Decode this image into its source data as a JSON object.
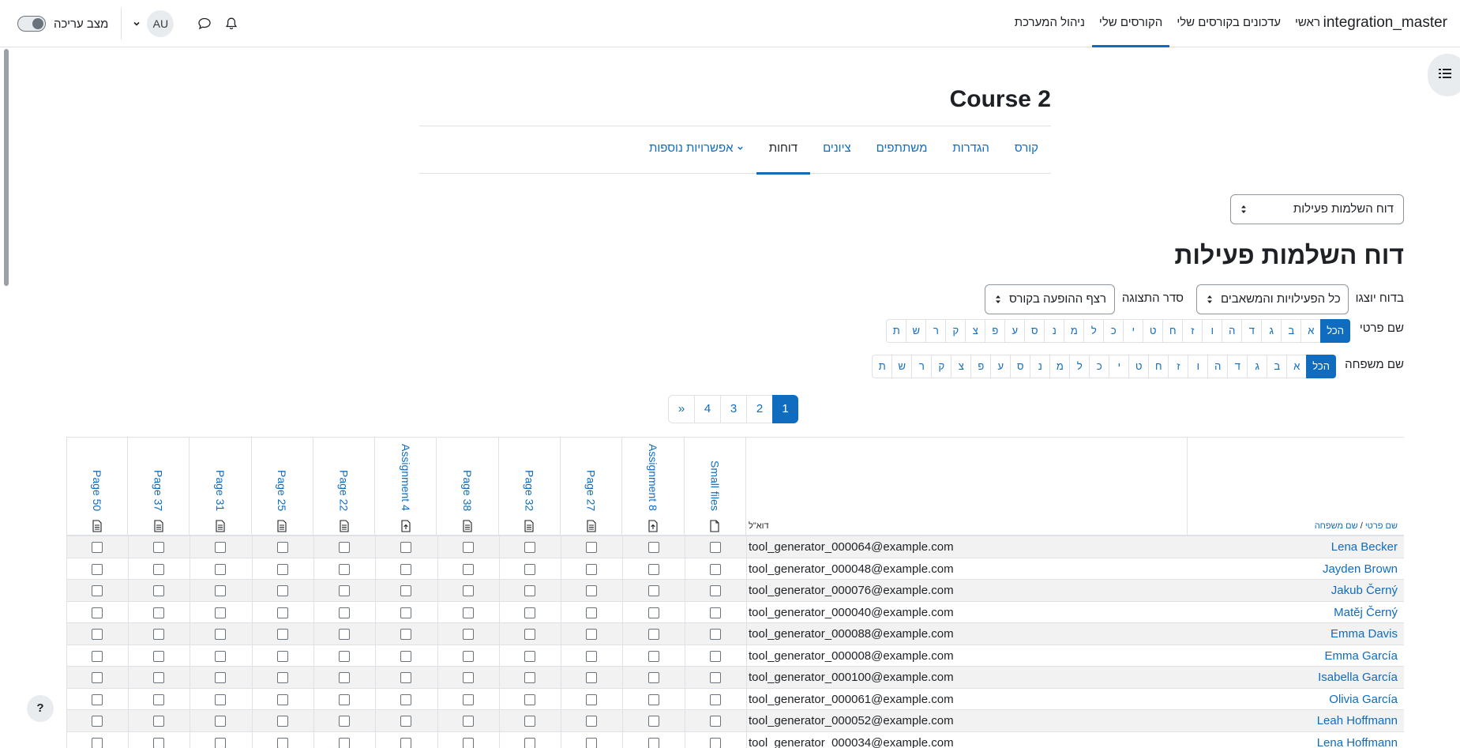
{
  "navbar": {
    "site_name": "integration_master",
    "items": [
      {
        "label": "ראשי",
        "active": false
      },
      {
        "label": "עדכונים בקורסים שלי",
        "active": false
      },
      {
        "label": "הקורסים שלי",
        "active": true
      },
      {
        "label": "ניהול המערכת",
        "active": false
      }
    ],
    "user_initials": "AU",
    "edit_mode_label": "מצב עריכה"
  },
  "course": {
    "title": "Course 2",
    "tabs": [
      "קורס",
      "הגדרות",
      "משתתפים",
      "ציונים",
      "דוחות",
      "אפשרויות נוספות"
    ],
    "active_tab": "דוחות"
  },
  "report": {
    "selector_value": "דוח השלמות פעילות",
    "heading": "דוח השלמות פעילות",
    "include_label": "בדוח יוצגו",
    "include_value": "כל הפעילויות והמשאבים",
    "order_label": "סדר התצוגה",
    "order_value": "רצף ההופעה בקורס",
    "firstname_label": "שם פרטי",
    "lastname_label": "שם משפחה",
    "letters": [
      "הכל",
      "א",
      "ב",
      "ג",
      "ד",
      "ה",
      "ו",
      "ז",
      "ח",
      "ט",
      "י",
      "כ",
      "ל",
      "מ",
      "נ",
      "ס",
      "ע",
      "פ",
      "צ",
      "ק",
      "ר",
      "ש",
      "ת"
    ],
    "pages": [
      "1",
      "2",
      "3",
      "4",
      "»"
    ],
    "current_page": "1"
  },
  "table": {
    "name_header_first": "שם פרטי",
    "name_header_sep": " / ",
    "name_header_last": "שם משפחה",
    "email_header": "דוא\"ל",
    "activities": [
      {
        "name": "Small files",
        "icon": "file-icon"
      },
      {
        "name": "Assignment 8",
        "icon": "assignment-icon"
      },
      {
        "name": "Page 27",
        "icon": "page-icon"
      },
      {
        "name": "Page 32",
        "icon": "page-icon"
      },
      {
        "name": "Page 38",
        "icon": "page-icon"
      },
      {
        "name": "Assignment 4",
        "icon": "assignment-icon"
      },
      {
        "name": "Page 22",
        "icon": "page-icon"
      },
      {
        "name": "Page 25",
        "icon": "page-icon"
      },
      {
        "name": "Page 31",
        "icon": "page-icon"
      },
      {
        "name": "Page 37",
        "icon": "page-icon"
      },
      {
        "name": "Page 50",
        "icon": "page-icon"
      }
    ],
    "rows": [
      {
        "name": "Lena Becker",
        "email": "tool_generator_000064@example.com"
      },
      {
        "name": "Jayden Brown",
        "email": "tool_generator_000048@example.com"
      },
      {
        "name": "Jakub Černý",
        "email": "tool_generator_000076@example.com"
      },
      {
        "name": "Matěj Černý",
        "email": "tool_generator_000040@example.com"
      },
      {
        "name": "Emma Davis",
        "email": "tool_generator_000088@example.com"
      },
      {
        "name": "Emma García",
        "email": "tool_generator_000008@example.com"
      },
      {
        "name": "Isabella García",
        "email": "tool_generator_000100@example.com"
      },
      {
        "name": "Olivia García",
        "email": "tool_generator_000061@example.com"
      },
      {
        "name": "Leah Hoffmann",
        "email": "tool_generator_000052@example.com"
      },
      {
        "name": "Lena Hoffmann",
        "email": "tool_generator_000034@example.com"
      }
    ]
  },
  "help": {
    "label": "?"
  }
}
